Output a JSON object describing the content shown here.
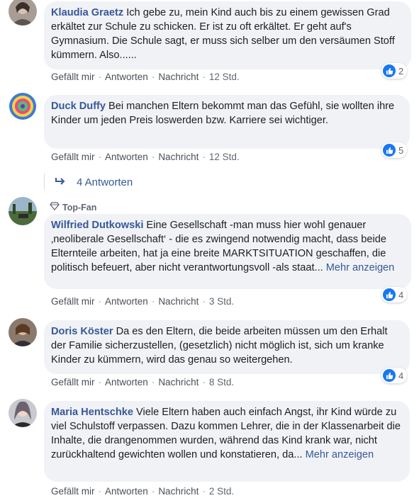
{
  "comments": [
    {
      "author": "Klaudia Graetz",
      "text": "Ich gebe zu, mein Kind auch bis zu einem gewissen Grad erkältet zur Schule zu schicken. Er ist zu oft erkältet. Er geht auf's Gymnasium. Die Schule sagt, er muss sich selber um den versäumen Stoff kümmern. Also......",
      "like": "Gefällt mir",
      "reply": "Antworten",
      "message": "Nachricht",
      "time": "12 Std.",
      "reactions": "2"
    },
    {
      "author": "Duck Duffy",
      "text": "Bei manchen Eltern bekommt man das Gefühl, sie wollten ihre Kinder um jeden Preis loswerden bzw. Karriere sei wichtiger.",
      "like": "Gefällt mir",
      "reply": "Antworten",
      "message": "Nachricht",
      "time": "12 Std.",
      "reactions": "5"
    },
    {
      "badge": "Top-Fan",
      "author": "Wilfried Dutkowski",
      "text": "Eine Gesellschaft -man muss hier wohl genauer ‚neoliberale Gesellschaft‘ - die es zwingend notwendig macht, dass beide Elternteile arbeiten, hat ja eine breite MARKTSITUATION geschaffen, die politisch befeuert, aber nicht verantwortungsvoll -als staat...",
      "more": "Mehr anzeigen",
      "like": "Gefällt mir",
      "reply": "Antworten",
      "message": "Nachricht",
      "time": "3 Std.",
      "reactions": "4"
    },
    {
      "author": "Doris Köster",
      "text": "Da es den Eltern, die beide arbeiten müssen um den Erhalt der Familie sicherzustellen, (gesetzlich) nicht möglich ist, sich um kranke Kinder zu kümmern, wird das genau so weitergehen.",
      "like": "Gefällt mir",
      "reply": "Antworten",
      "message": "Nachricht",
      "time": "8 Std.",
      "reactions": "4"
    },
    {
      "author": "Maria Hentschke",
      "text": "Viele Eltern haben auch einfach Angst, ihr Kind würde zu viel Schulstoff verpassen. Dazu kommen Lehrer, die in der Klassenarbeit die Inhalte, die drangenommen wurden, während das Kind krank war, nicht zurückhaltend gewichten wollen und konstatieren, da...",
      "more": "Mehr anzeigen",
      "like": "Gefällt mir",
      "reply": "Antworten",
      "message": "Nachricht",
      "time": "2 Std."
    }
  ],
  "replies_link": "4 Antworten",
  "separator": "·",
  "colors": {
    "author": "#385898",
    "bubble": "#f0f2f5",
    "like": "#1877f2"
  }
}
